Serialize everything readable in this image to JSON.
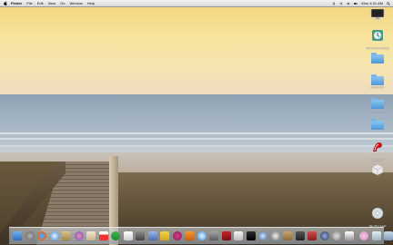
{
  "menubar": {
    "app_name": "Finder",
    "items": [
      "File",
      "Edit",
      "View",
      "Go",
      "Window",
      "Help"
    ],
    "clock": "Mon 4:31 AM"
  },
  "desktop_icons": [
    {
      "name": "display-icon",
      "label": ""
    },
    {
      "name": "time-machine-icon",
      "label": "Time Machine Backups"
    },
    {
      "name": "folder-icon",
      "label": ""
    },
    {
      "name": "folder-icon",
      "label": "Untitled folder"
    },
    {
      "name": "folder-icon",
      "label": "Untitled folder"
    },
    {
      "name": "folder-icon",
      "label": ""
    },
    {
      "name": "app-icon",
      "label": "Flash Player"
    },
    {
      "name": "drive-icon",
      "label": ""
    },
    {
      "name": "disk-icon",
      "label": "Mac OS X Install"
    }
  ],
  "dock": {
    "items": [
      "finder",
      "launchpad",
      "firefox",
      "safari",
      "mail",
      "photos",
      "contacts",
      "calendar",
      "notes",
      "reminders",
      "maps",
      "messages",
      "facetime",
      "itunes",
      "ibooks",
      "app-store",
      "system-preferences",
      "preview",
      "textedit",
      "terminal",
      "activity-monitor",
      "disk-utility",
      "utilities",
      "camera",
      "photo-booth",
      "quicktime",
      "dvd-player",
      "chess",
      "stickies",
      "downloads",
      "documents",
      "trash"
    ]
  }
}
